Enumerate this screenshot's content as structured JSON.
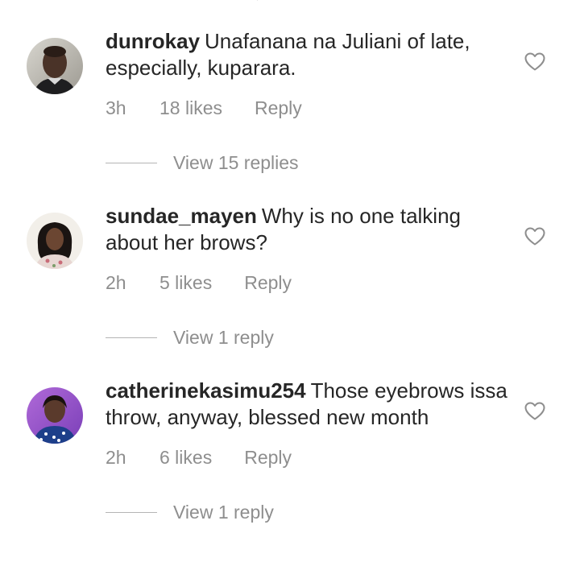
{
  "comments": [
    {
      "username": "dunrokay",
      "text": "Unafanana na Juliani of late, especially, kuparara.",
      "time": "3h",
      "likes": "18 likes",
      "reply_label": "Reply",
      "view_replies": "View 15 replies",
      "avatar_icon": "person-avatar",
      "heart_icon": "heart-outline-icon"
    },
    {
      "username": "sundae_mayen",
      "text": "Why is no one talking about her brows?",
      "time": "2h",
      "likes": "5 likes",
      "reply_label": "Reply",
      "view_replies": "View 1 reply",
      "avatar_icon": "person-avatar",
      "heart_icon": "heart-outline-icon"
    },
    {
      "username": "catherinekasimu254",
      "text": "Those eyebrows issa throw, anyway, blessed new month",
      "time": "2h",
      "likes": "6 likes",
      "reply_label": "Reply",
      "view_replies": "View 1 reply",
      "avatar_icon": "person-avatar",
      "heart_icon": "heart-outline-icon"
    }
  ],
  "colors": {
    "text": "#262626",
    "secondary": "#8e8e8e",
    "divider": "#b5b5b5"
  }
}
